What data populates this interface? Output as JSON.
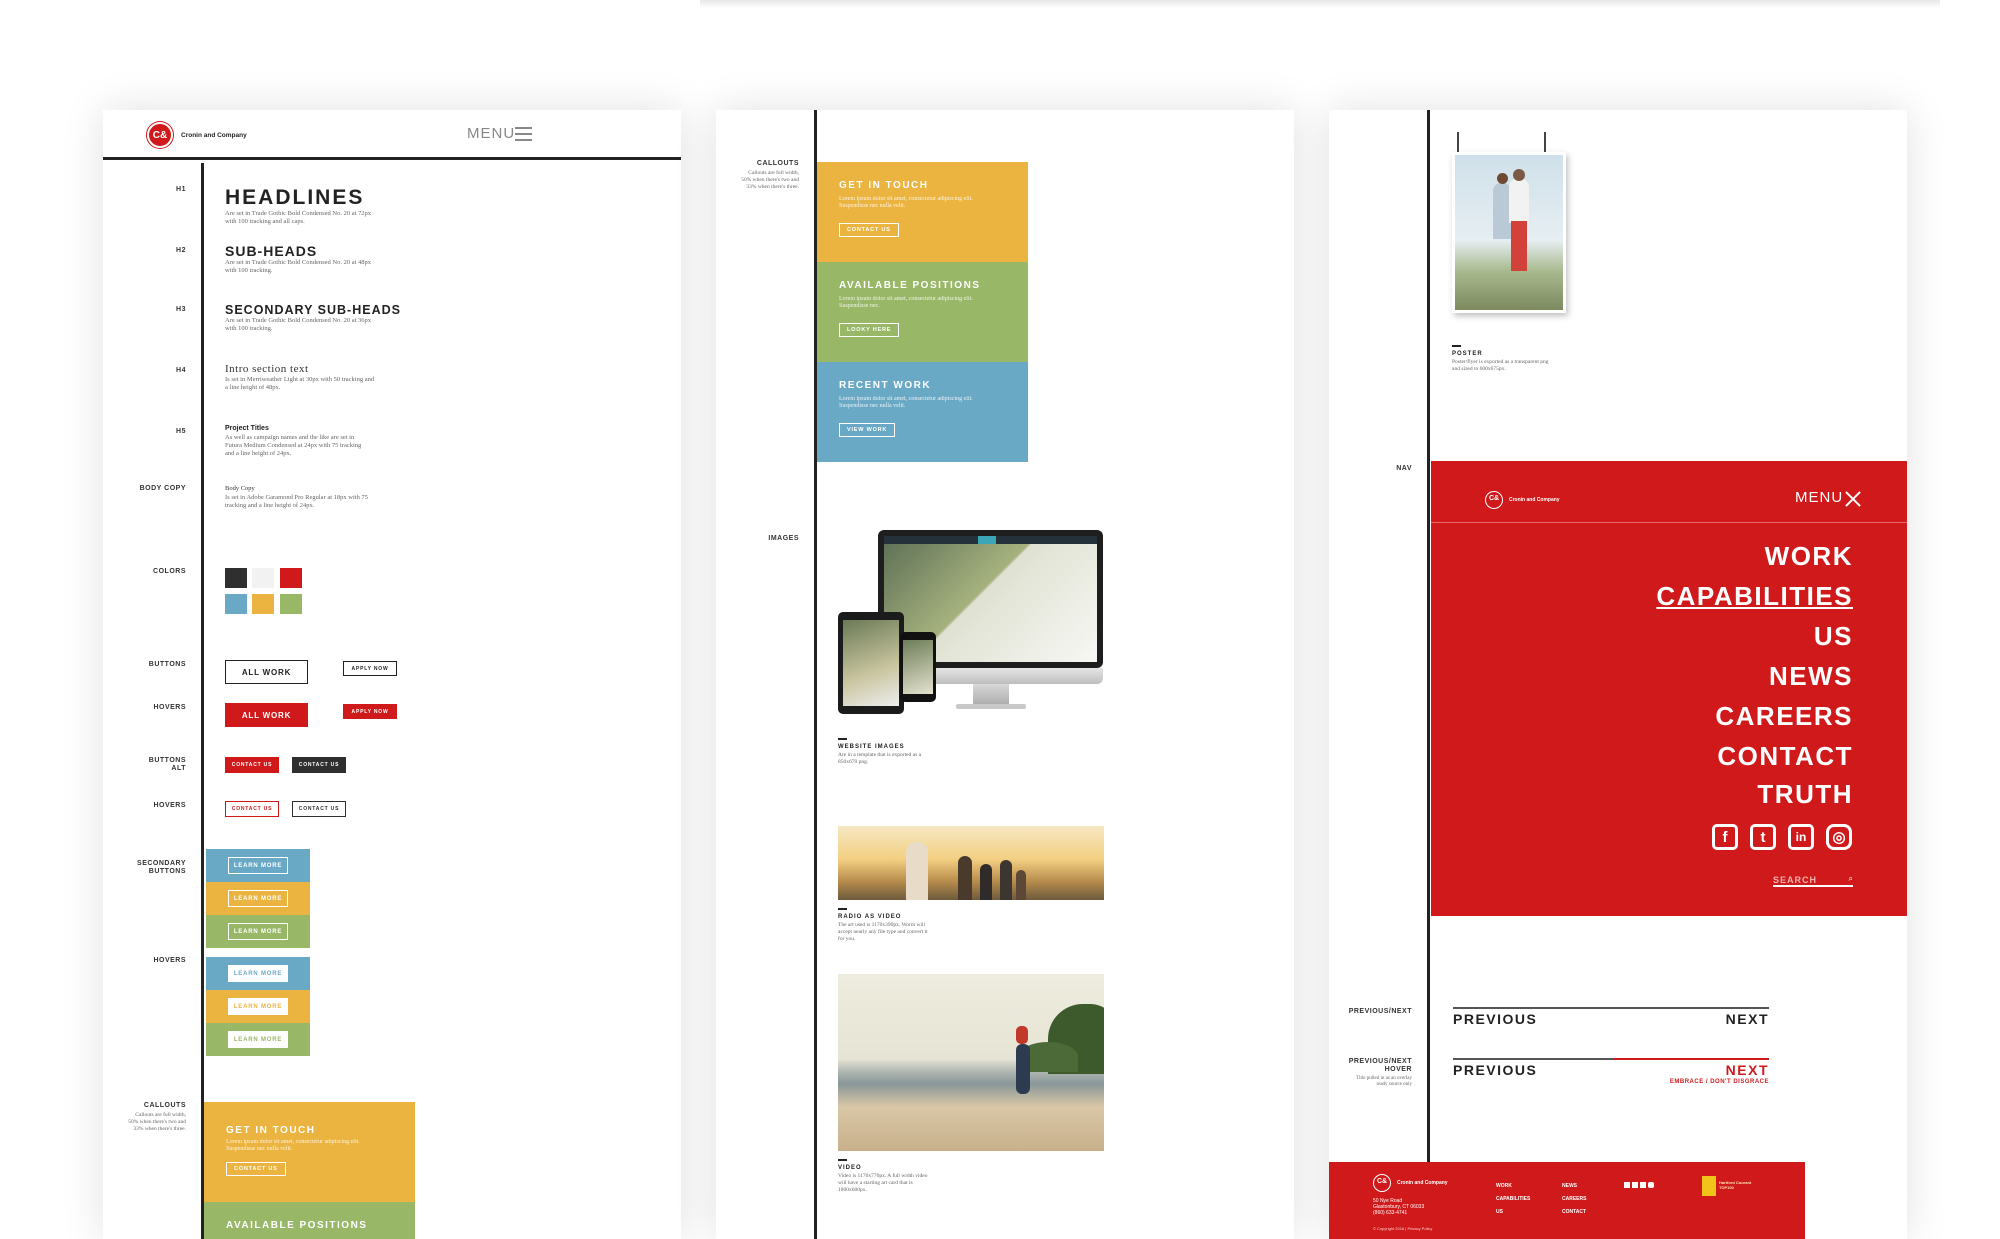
{
  "colors": {
    "red": "#d0191a",
    "dark": "#2f2f2f",
    "light": "#f2f2f2",
    "blue": "#6aa9c5",
    "yellow": "#ebb33f",
    "green": "#98b767",
    "rule": "#222222"
  },
  "panel1": {
    "brand": "Cronin and Company",
    "menu": "MENU",
    "labels": {
      "h1": "H1",
      "h2": "H2",
      "h3": "H3",
      "h4": "H4",
      "h5": "H5",
      "body": "BODY COPY",
      "colors": "COLORS",
      "buttons": "BUTTONS",
      "hovers": "HOVERS",
      "buttons_alt_1": "BUTTONS",
      "buttons_alt_2": "ALT",
      "hovers2": "HOVERS",
      "secondary_1": "SECONDARY",
      "secondary_2": "BUTTONS",
      "hovers3": "HOVERS",
      "callouts": "CALLOUTS"
    },
    "callouts_desc": "Callouts are full width, 50% when there's two and 33% when there's three.",
    "type": {
      "h1_title": "HEADLINES",
      "h1_desc": "Are set in Trade Gothic Bold Condensed No. 20 at 72px with 100 tracking and all caps.",
      "h2_title": "SUB-HEADS",
      "h2_desc": "Are set in Trade Gothic Bold Condensed No. 20 at 48px with 100 tracking.",
      "h3_title": "SECONDARY SUB-HEADS",
      "h3_desc": "Are set in Trade Gothic Bold Condensed No. 20 at 36px with 100 tracking.",
      "h4_title": "Intro section text",
      "h4_desc": "Is set in Merriweather Light at 30px with 50 tracking and a line height of 48px.",
      "h5_title": "Project Titles",
      "h5_desc": "As well as campaign names and the like are set in Futura Medium Condensed at 24px with 75 tracking and a line height of 24px.",
      "body_title": "Body Copy",
      "body_desc": "Is set in Adobe Garamond Pro Regular at 18px with 75 tracking and a line height of 24px."
    },
    "buttons": {
      "all_work": "ALL WORK",
      "apply_now": "APPLY NOW",
      "contact_us": "CONTACT US",
      "learn_more": "LEARN MORE"
    },
    "callouts": [
      {
        "title": "GET IN TOUCH",
        "desc": "Lorem ipsum dolor sit amet, consectetur adipiscing elit. Suspendisse nec nulla velit.",
        "button": "CONTACT US"
      },
      {
        "title": "AVAILABLE POSITIONS"
      }
    ]
  },
  "panel2": {
    "labels": {
      "callouts": "CALLOUTS",
      "images": "IMAGES"
    },
    "callouts_desc": "Callouts are full width, 50% when there's two and 33% when there's three.",
    "callouts": [
      {
        "title": "GET IN TOUCH",
        "desc": "Lorem ipsum dolor sit amet, consectetur adipiscing elit. Suspendisse nec nulla velit.",
        "button": "CONTACT US"
      },
      {
        "title": "AVAILABLE POSITIONS",
        "desc": "Lorem ipsum dolor sit amet, consectetur adipiscing elit. Suspendisse nec.",
        "button": "LOOKY HERE"
      },
      {
        "title": "RECENT WORK",
        "desc": "Lorem ipsum dolor sit amet, consectetur adipiscing elit. Suspendisse nec nulla velit.",
        "button": "VIEW WORK"
      }
    ],
    "images": [
      {
        "title": "WEBSITE IMAGES",
        "desc": "Are in a template that is exported as a 850x670 png."
      },
      {
        "title": "RADIO AS VIDEO",
        "desc": "The art used is 1170x390px. Worm will accept nearly any file type and convert it for you."
      },
      {
        "title": "VIDEO",
        "desc": "Video is 1170x770px. A full width video will have a starting art card that is 1800x600px."
      }
    ]
  },
  "panel3": {
    "poster_title": "POSTER",
    "poster_desc": "Poster/flyer is exported as a transparent png and sized to 600x675px.",
    "labels": {
      "nav": "NAV",
      "prevnext": "PREVIOUS/NEXT",
      "prevnext_hover_1": "PREVIOUS/NEXT",
      "prevnext_hover_2": "HOVER"
    },
    "prevnext_hover_desc": "Title pulled in as an overlay ready source only",
    "nav": {
      "brand": "Cronin and Company",
      "menu": "MENU",
      "items": [
        "WORK",
        "CAPABILITIES",
        "US",
        "NEWS",
        "CAREERS",
        "CONTACT",
        "TRUTH"
      ],
      "search": "SEARCH"
    },
    "prev": "PREVIOUS",
    "next": "NEXT",
    "hover_title": "EMBRACE / DON'T DISGRACE",
    "footer": {
      "brand": "Cronin and Company",
      "address_1": "50 Nye Road",
      "address_2": "Glastonbury, CT 06033",
      "phone": "(860) 633-4741",
      "links_a": [
        "WORK",
        "CAPABILITIES",
        "US"
      ],
      "links_b": [
        "NEWS",
        "CAREERS",
        "CONTACT"
      ],
      "badge": "Hartford Courant TOP100",
      "copyright": "© Copyright 2016 | Privacy Policy"
    }
  }
}
